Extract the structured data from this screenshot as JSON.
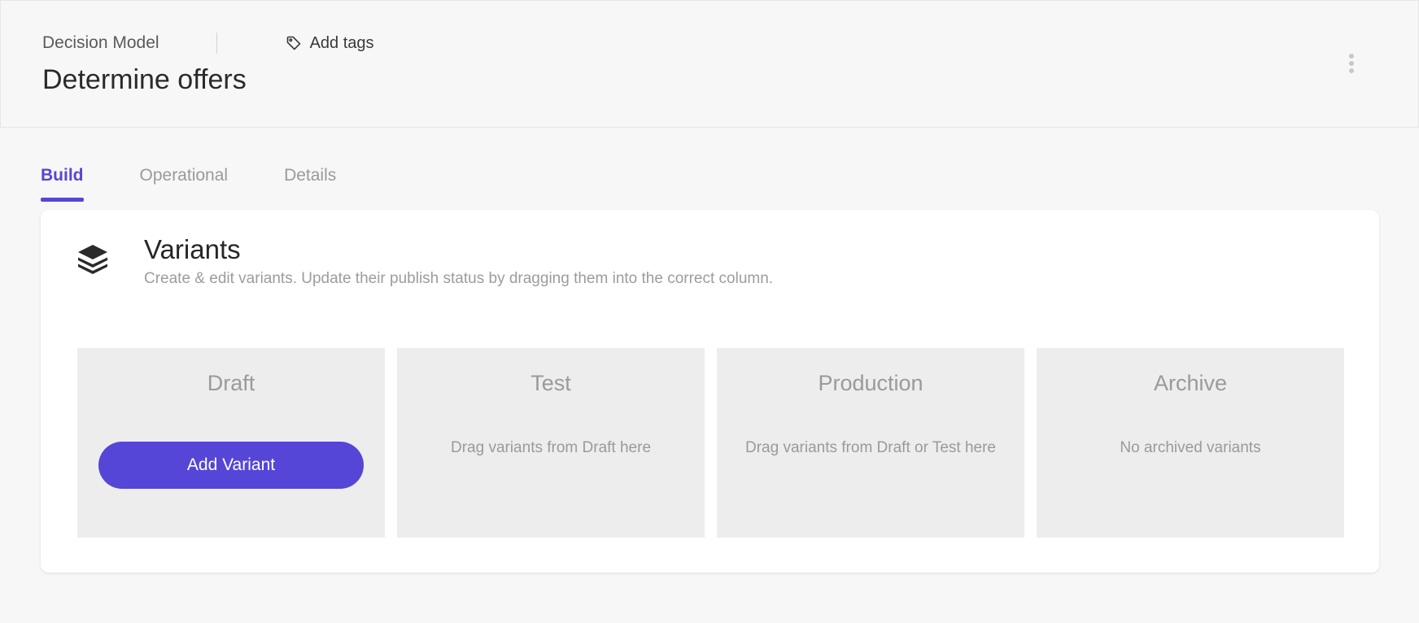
{
  "header": {
    "model_type": "Decision Model",
    "add_tags_label": "Add tags",
    "title": "Determine offers",
    "more_icon": "more-vertical-icon",
    "tag_icon": "tag-icon"
  },
  "tabs": [
    {
      "label": "Build",
      "active": true
    },
    {
      "label": "Operational",
      "active": false
    },
    {
      "label": "Details",
      "active": false
    }
  ],
  "variants": {
    "icon": "layers-icon",
    "title": "Variants",
    "subtitle": "Create & edit variants. Update their publish status by dragging them into the correct column.",
    "columns": [
      {
        "title": "Draft",
        "button_label": "Add Variant"
      },
      {
        "title": "Test",
        "hint": "Drag variants from Draft here"
      },
      {
        "title": "Production",
        "hint": "Drag variants from Draft or Test here"
      },
      {
        "title": "Archive",
        "hint": "No archived variants"
      }
    ]
  },
  "colors": {
    "accent": "#5546d8",
    "background": "#f7f7f7",
    "column_bg": "#ededed"
  }
}
